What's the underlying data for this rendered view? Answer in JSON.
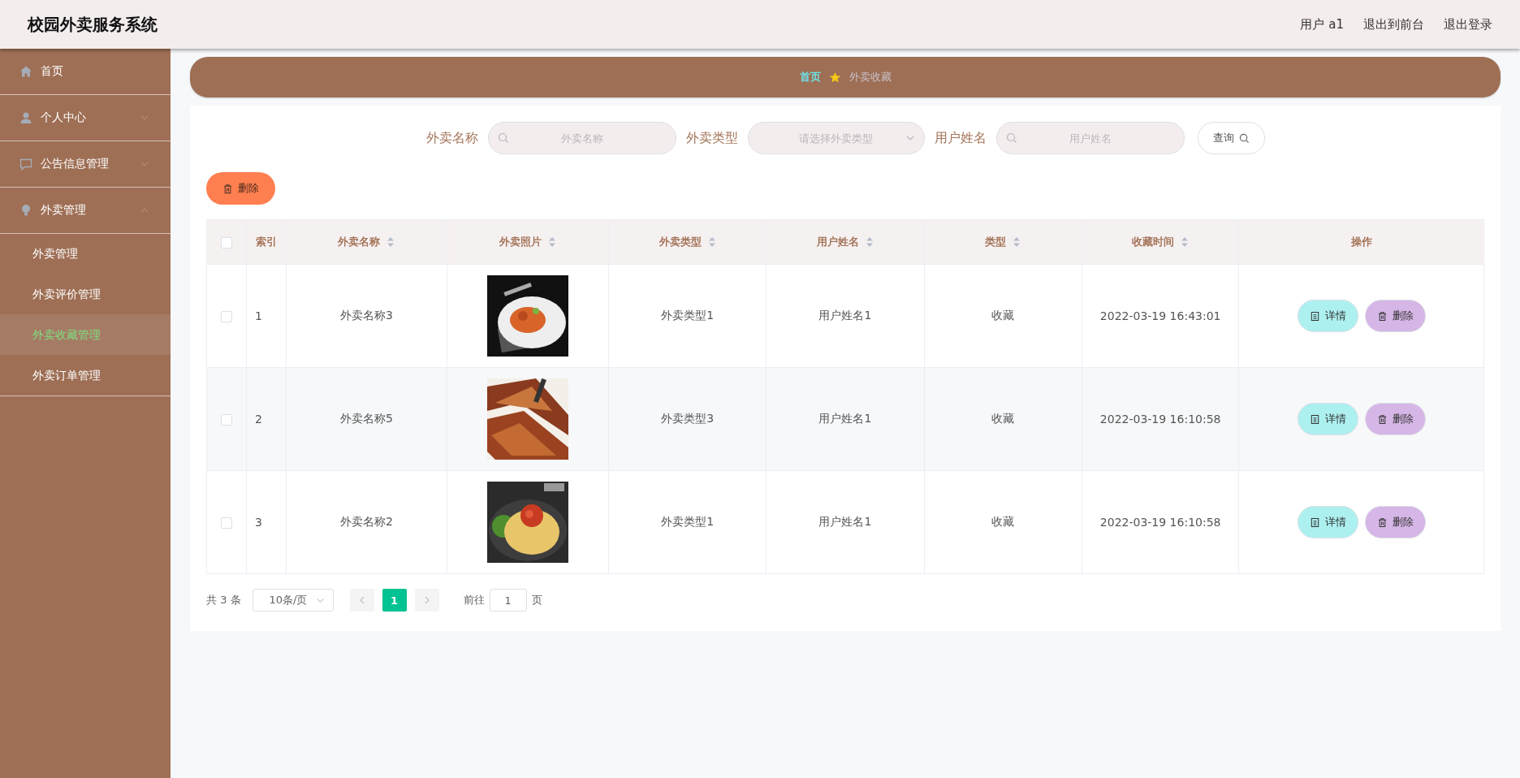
{
  "header": {
    "title": "校园外卖服务系统",
    "links": [
      "用户 a1",
      "退出到前台",
      "退出登录"
    ]
  },
  "sidebar": {
    "items": [
      {
        "label": "首页"
      },
      {
        "label": "个人中心",
        "expanded": false
      },
      {
        "label": "公告信息管理",
        "expanded": false
      },
      {
        "label": "外卖管理",
        "expanded": true,
        "children": [
          {
            "label": "外卖管理",
            "selected": false
          },
          {
            "label": "外卖评价管理",
            "selected": false
          },
          {
            "label": "外卖收藏管理",
            "selected": true
          },
          {
            "label": "外卖订单管理",
            "selected": false
          }
        ]
      }
    ]
  },
  "breadcrumb": {
    "home": "首页",
    "current": "外卖收藏"
  },
  "search": {
    "fields": [
      {
        "label": "外卖名称",
        "placeholder": "外卖名称",
        "kind": "input"
      },
      {
        "label": "外卖类型",
        "placeholder": "请选择外卖类型",
        "kind": "select"
      },
      {
        "label": "用户姓名",
        "placeholder": "用户姓名",
        "kind": "input"
      }
    ],
    "button": "查询"
  },
  "delete_button": "删除",
  "table": {
    "select_all_checked": false,
    "columns": [
      {
        "label": "索引",
        "sortable": false
      },
      {
        "label": "外卖名称",
        "sortable": true
      },
      {
        "label": "外卖照片",
        "sortable": true
      },
      {
        "label": "外卖类型",
        "sortable": true
      },
      {
        "label": "用户姓名",
        "sortable": true
      },
      {
        "label": "类型",
        "sortable": true
      },
      {
        "label": "收藏时间",
        "sortable": true
      },
      {
        "label": "操作",
        "sortable": false
      }
    ],
    "rows": [
      {
        "checked": false,
        "index": "1",
        "name": "外卖名称3",
        "type": "外卖类型1",
        "user": "用户姓名1",
        "kind_text": "收藏",
        "time": "2022-03-19 16:43:01",
        "actions": [
          "详情",
          "删除"
        ]
      },
      {
        "checked": false,
        "index": "2",
        "name": "外卖名称5",
        "type": "外卖类型3",
        "user": "用户姓名1",
        "kind_text": "收藏",
        "time": "2022-03-19 16:10:58",
        "actions": [
          "详情",
          "删除"
        ]
      },
      {
        "checked": false,
        "index": "3",
        "name": "外卖名称2",
        "type": "外卖类型1",
        "user": "用户姓名1",
        "kind_text": "收藏",
        "time": "2022-03-19 16:10:58",
        "actions": [
          "详情",
          "删除"
        ]
      }
    ]
  },
  "pagination": {
    "total": "共 3 条",
    "page_size": "10条/页",
    "pages": [
      {
        "label": "1",
        "selected": true
      }
    ],
    "goto_label": "前往",
    "goto_value": "1",
    "goto_suffix": "页"
  }
}
